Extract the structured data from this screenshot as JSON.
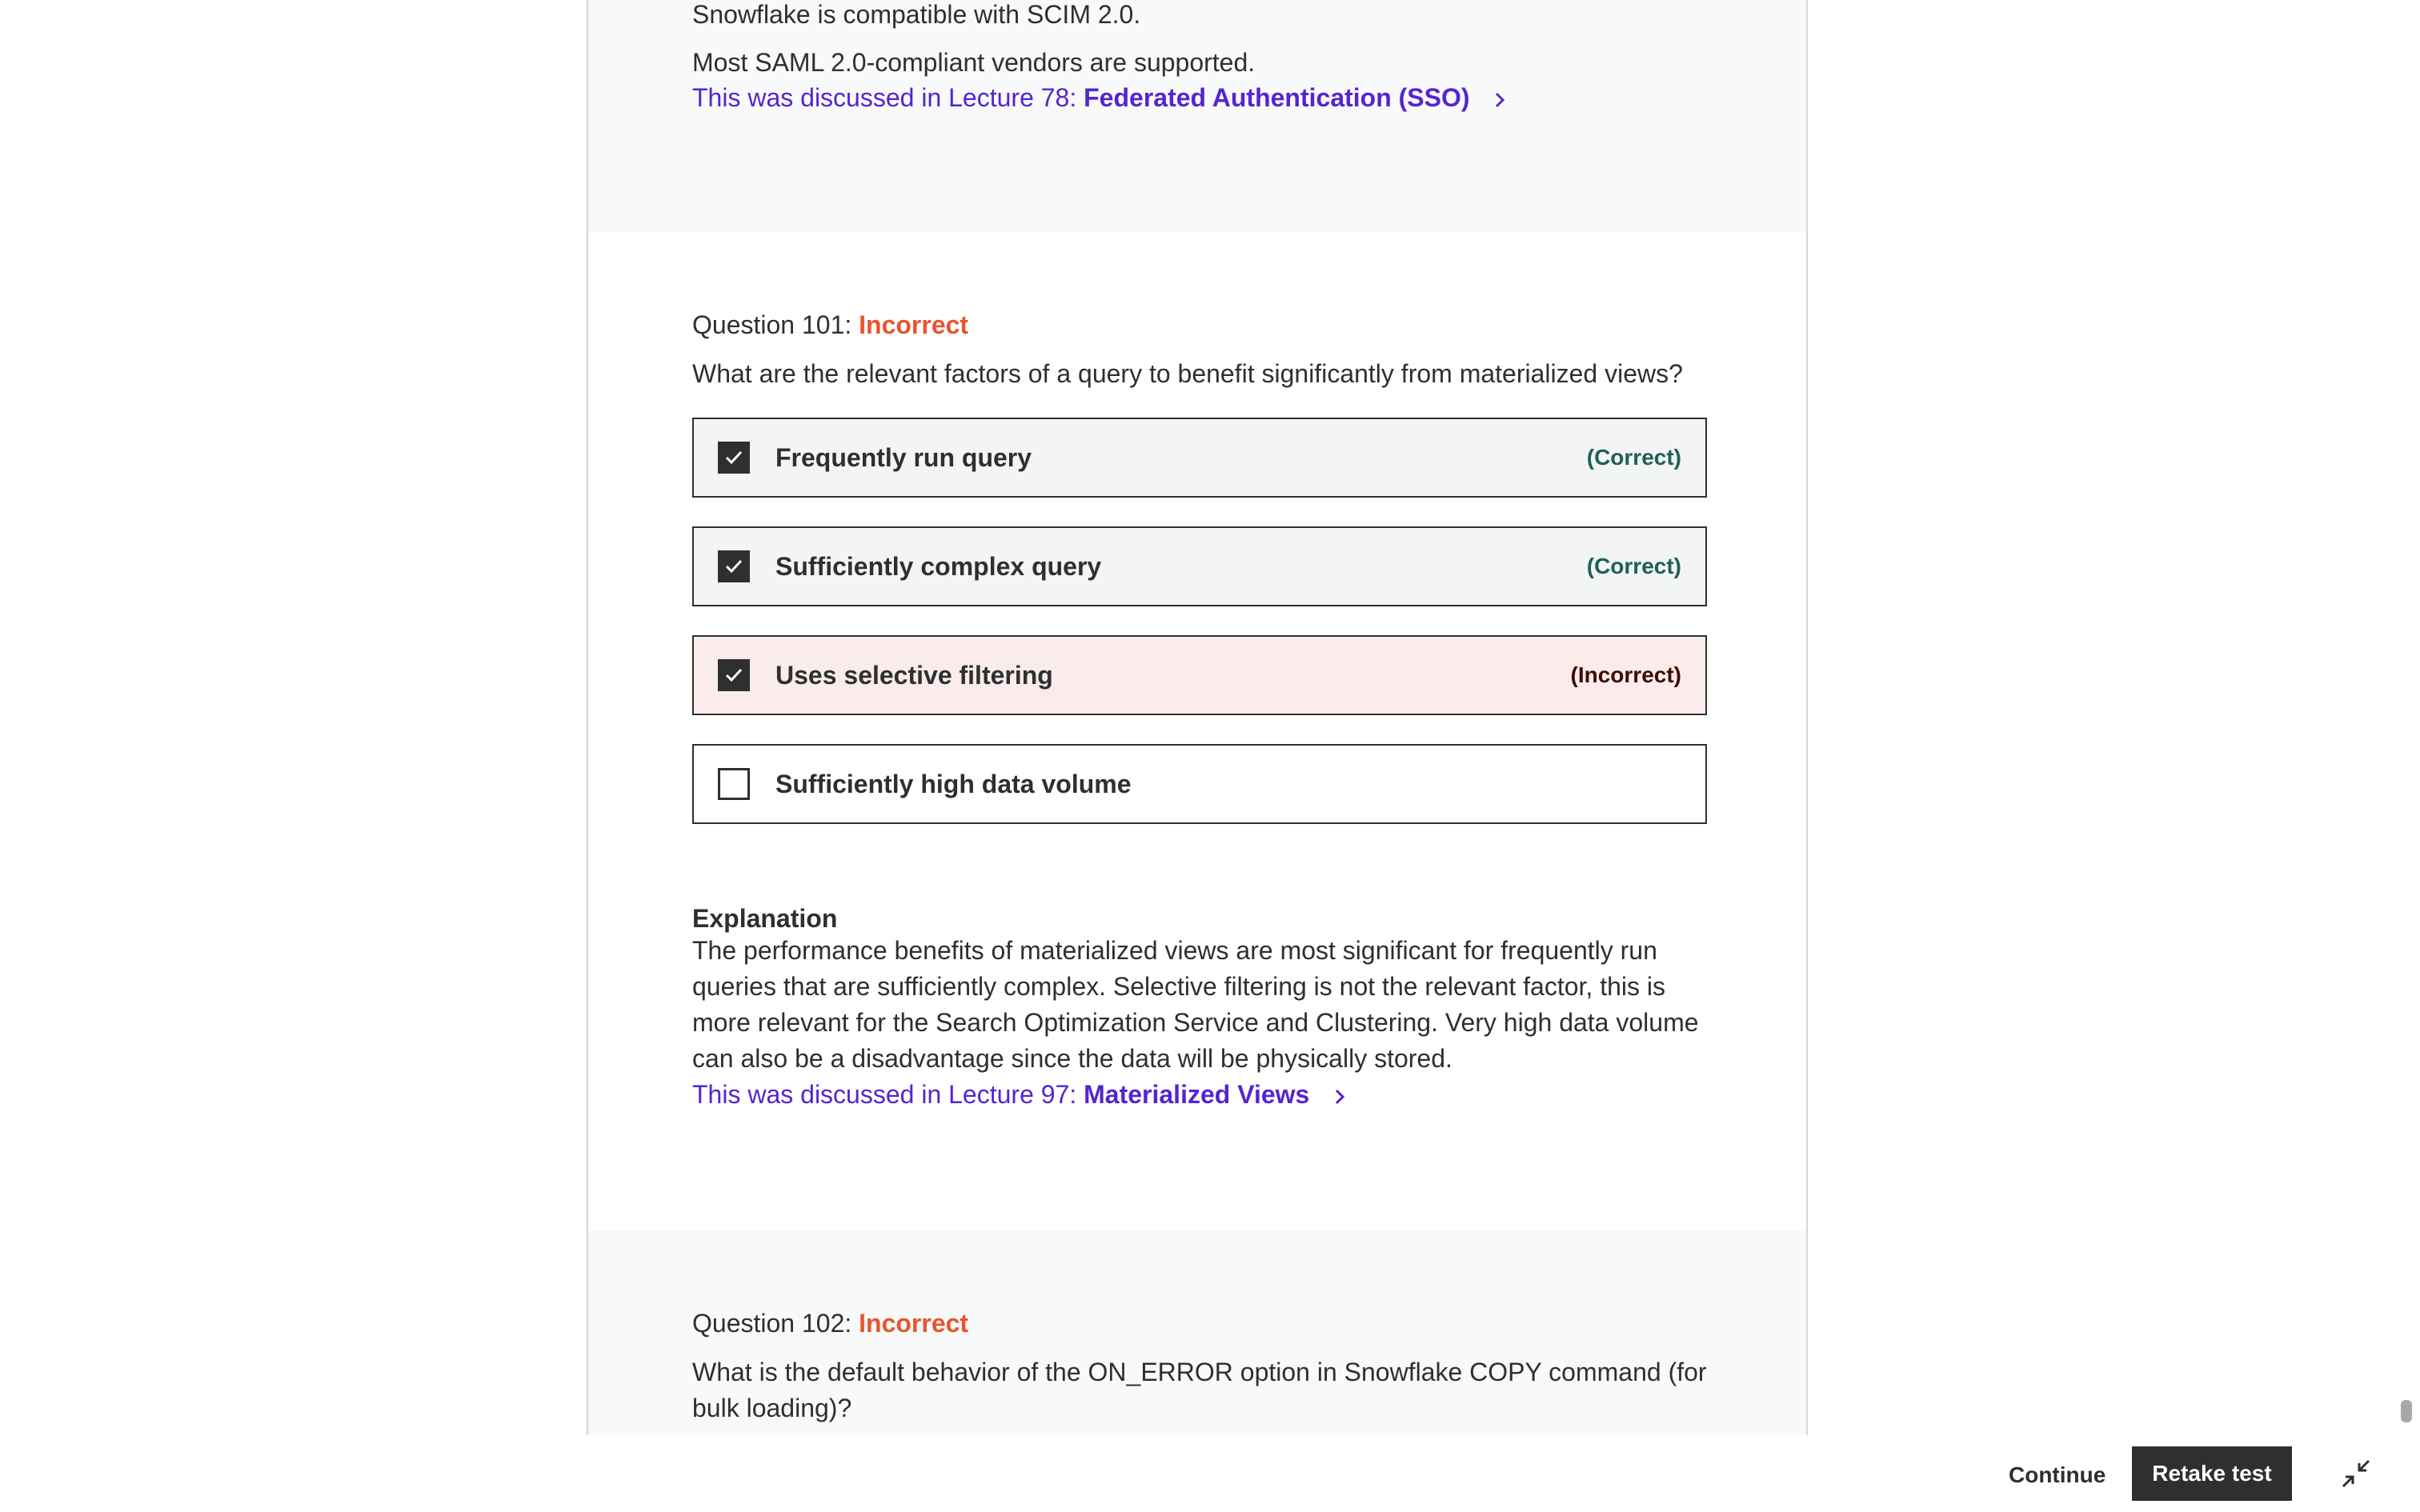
{
  "prev_question": {
    "line1": "Snowflake is compatible with SCIM 2.0.",
    "line2": "Most SAML 2.0-compliant vendors are supported.",
    "lecture_prefix": "This was discussed in Lecture 78:",
    "lecture_title": "Federated Authentication (SSO)"
  },
  "question101": {
    "label": "Question 101:",
    "status": "Incorrect",
    "text": "What are the relevant factors of a query to benefit significantly from materialized views?",
    "options": [
      {
        "label": "Frequently run query",
        "checked": true,
        "result": "(Correct)"
      },
      {
        "label": "Sufficiently complex query",
        "checked": true,
        "result": "(Correct)"
      },
      {
        "label": "Uses selective filtering",
        "checked": true,
        "result": "(Incorrect)"
      },
      {
        "label": "Sufficiently high data volume",
        "checked": false,
        "result": ""
      }
    ],
    "explanation_title": "Explanation",
    "explanation_lines": [
      "The performance benefits of materialized views are most significant for frequently run",
      "queries that are sufficiently complex. Selective filtering is not the relevant factor, this is",
      "more relevant for the Search Optimization Service and Clustering. Very high data volume",
      "can also be a disadvantage since the data will be physically stored."
    ],
    "lecture_prefix": "This was discussed in Lecture 97:",
    "lecture_title": "Materialized Views"
  },
  "question102": {
    "label": "Question 102:",
    "status": "Incorrect",
    "text_line1": "What is the default behavior of the ON_ERROR option in Snowflake COPY command (for",
    "text_line2": "bulk loading)?"
  },
  "footer": {
    "continue_label": "Continue",
    "retake_label": "Retake test"
  },
  "colors": {
    "link": "#5624d0",
    "incorrect_status": "#e8552d",
    "correct_bg": "#f2f5f4",
    "incorrect_bg": "#f9ecea",
    "dark": "#2d2f31"
  },
  "icons": {
    "chevron": "chevron-right-icon",
    "check": "checkmark-icon",
    "collapse": "collapse-icon"
  }
}
